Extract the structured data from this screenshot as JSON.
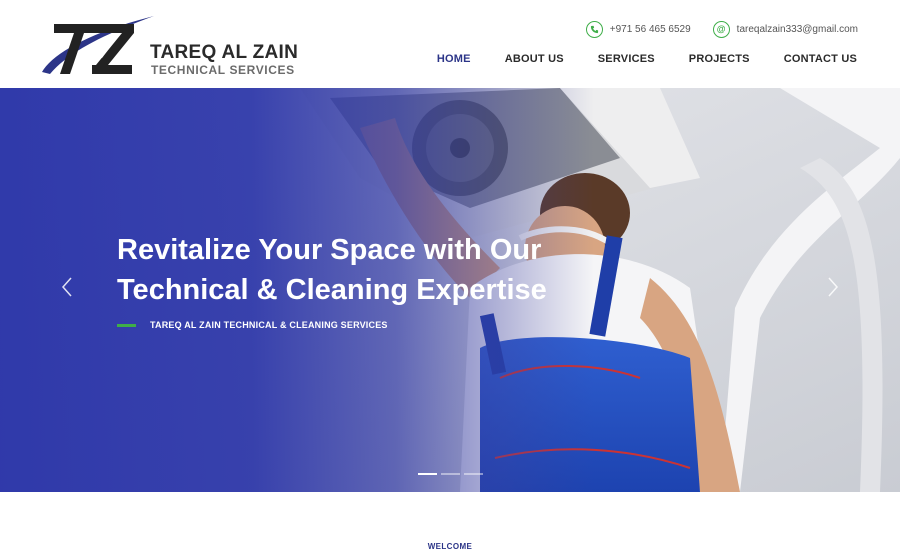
{
  "brand": {
    "name": "TAREQ AL ZAIN",
    "tagline": "TECHNICAL SERVICES",
    "colors": {
      "primary": "#2c3588",
      "accent": "#3fae49",
      "dark": "#2a2a2a"
    }
  },
  "contact": {
    "phone": "+971 56 465 6529",
    "phone_icon": "phone-icon",
    "email": "tareqalzain333@gmail.com",
    "email_icon": "email-icon"
  },
  "nav": {
    "items": [
      {
        "label": "HOME",
        "active": true
      },
      {
        "label": "ABOUT US",
        "active": false
      },
      {
        "label": "SERVICES",
        "active": false
      },
      {
        "label": "PROJECTS",
        "active": false
      },
      {
        "label": "CONTACT US",
        "active": false
      }
    ]
  },
  "hero": {
    "title_line1": "Revitalize Your Space with Our",
    "title_line2": "Technical & Cleaning Expertise",
    "subtitle": "TAREQ AL ZAIN TECHNICAL & CLEANING SERVICES",
    "prev_icon": "chevron-left-icon",
    "next_icon": "chevron-right-icon",
    "slides_total": 3,
    "active_slide": 1
  },
  "section": {
    "welcome_label": "WELCOME"
  }
}
